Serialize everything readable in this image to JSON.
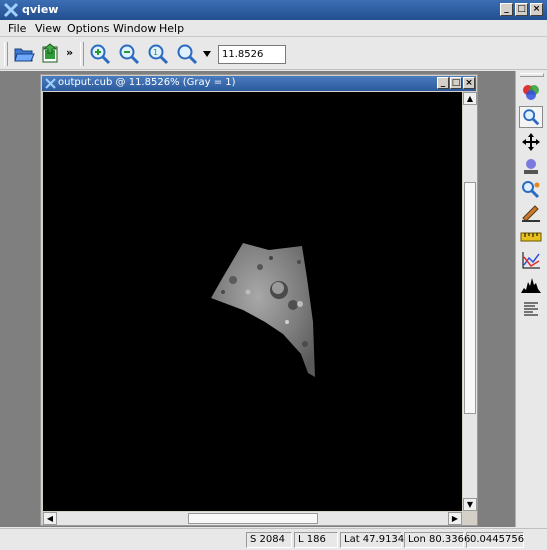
{
  "window": {
    "title": "qview"
  },
  "menu": {
    "items": [
      {
        "label": "File"
      },
      {
        "label": "View"
      },
      {
        "label": "Options"
      },
      {
        "label": "Window"
      },
      {
        "label": "Help"
      }
    ]
  },
  "toolbar": {
    "zoom_value": "11.8526",
    "overflow_label": "»"
  },
  "subwindow": {
    "title": "output.cub @ 11.8526% (Gray = 1)"
  },
  "status": {
    "sample": "S 2084",
    "line": "L 186",
    "lat": "Lat 47.9134",
    "lon": "Lon 80.3366",
    "value": "0.0445756"
  },
  "colors": {
    "titlebar": "#2c5a9c",
    "workspace": "#7f7f7f",
    "canvas": "#000000"
  },
  "icons": {
    "toolbar": [
      "open-file-icon",
      "export-icon",
      "zoom-in-icon",
      "zoom-out-icon",
      "zoom-actual-icon",
      "zoom-fit-icon"
    ],
    "tools": [
      "band-select-icon",
      "zoom-tool-icon",
      "pan-tool-icon",
      "stretch-tool-icon",
      "find-tool-icon",
      "edit-tool-icon",
      "measure-tool-icon",
      "plot-tool-icon",
      "histogram-tool-icon",
      "advanced-tracking-icon"
    ]
  }
}
